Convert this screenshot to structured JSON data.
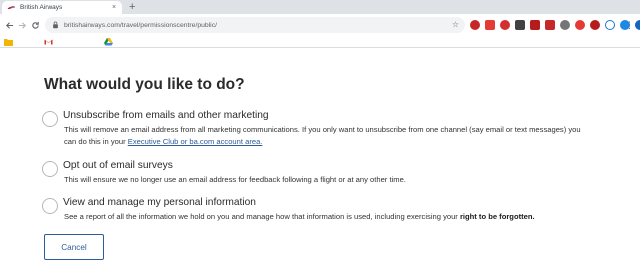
{
  "browser": {
    "tab_title": "British Airways",
    "tab_close": "×",
    "new_tab": "+",
    "url": "britishairways.com/travel/permissionscentre/public/",
    "colors": {
      "chrome_bg": "#dee1e6",
      "omnibox_bg": "#f1f3f4"
    }
  },
  "page": {
    "heading": "What would you like to do?",
    "options": [
      {
        "title": "Unsubscribe from emails and other marketing",
        "desc_line1": "This will remove an email address from all marketing communications. If you only want to unsubscribe from one channel (say email or text messages) you",
        "desc_line2_pre": "can do this in your ",
        "desc_link": "Executive Club or ba.com account area."
      },
      {
        "title": "Opt out of email surveys",
        "desc": "This will ensure we no longer use an email address for feedback following a flight or at any other time."
      },
      {
        "title": "View and manage my personal information",
        "desc_pre": "See a report of all the information we hold on you and manage how that information is used, including exercising your ",
        "desc_bold": "right to be forgotten."
      }
    ],
    "cancel_label": "Cancel",
    "colors": {
      "link": "#2e5c99",
      "text": "#2b2b2b"
    }
  }
}
